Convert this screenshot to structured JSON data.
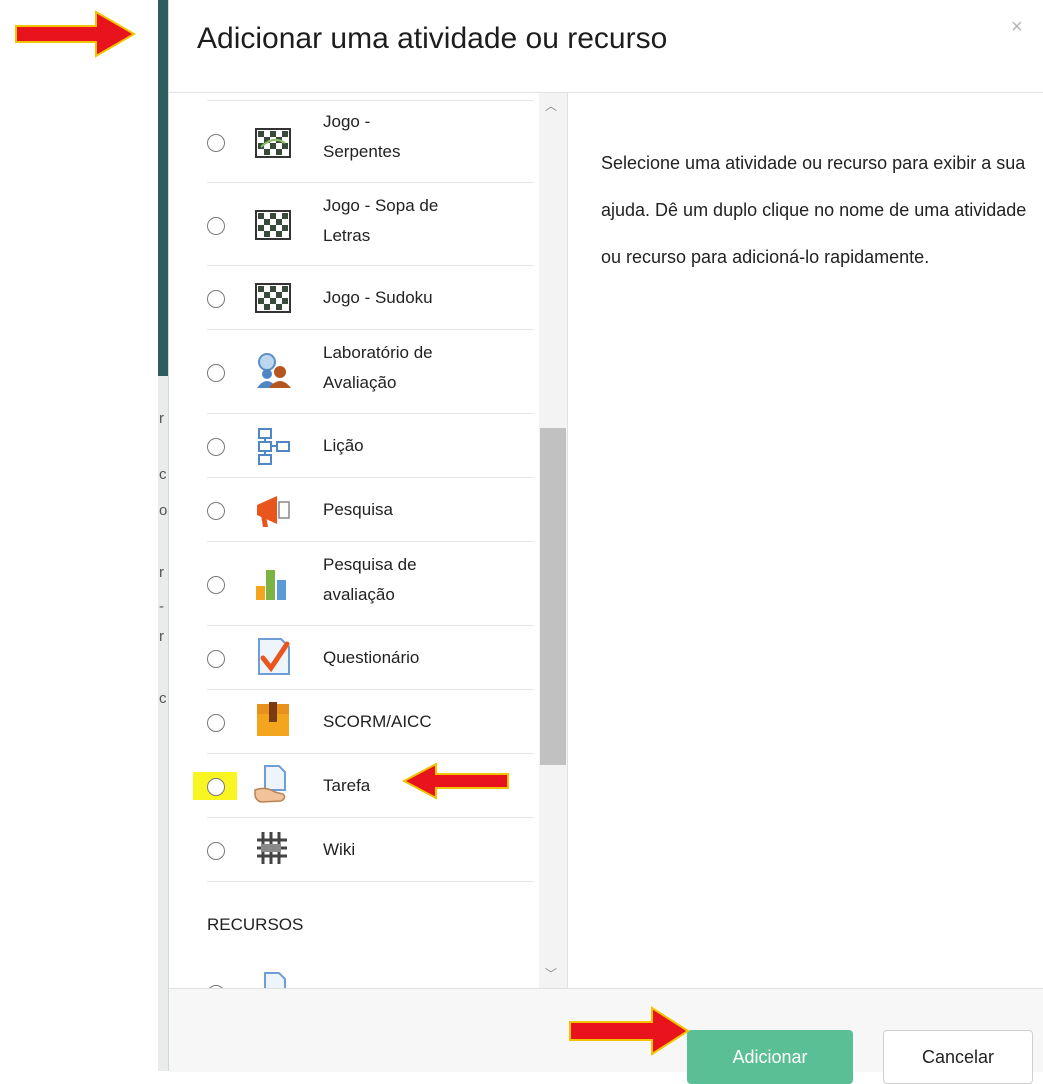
{
  "background": {
    "letters": [
      "r",
      "c",
      "o",
      "r",
      "-",
      "r",
      "c"
    ]
  },
  "modal": {
    "title": "Adicionar uma atividade ou recurso",
    "close_label": "×",
    "options": [
      {
        "label": "Jogo -\nSerpentes",
        "icon": "snakes-game-icon"
      },
      {
        "label": "Jogo - Sopa de\nLetras",
        "icon": "word-search-game-icon"
      },
      {
        "label": "Jogo - Sudoku",
        "icon": "sudoku-game-icon"
      },
      {
        "label": "Laboratório de\nAvaliação",
        "icon": "workshop-icon"
      },
      {
        "label": "Lição",
        "icon": "lesson-icon"
      },
      {
        "label": "Pesquisa",
        "icon": "megaphone-icon"
      },
      {
        "label": "Pesquisa de\navaliação",
        "icon": "bar-chart-icon"
      },
      {
        "label": "Questionário",
        "icon": "quiz-icon"
      },
      {
        "label": "SCORM/AICC",
        "icon": "scorm-package-icon"
      },
      {
        "label": "Tarefa",
        "icon": "assignment-icon"
      },
      {
        "label": "Wiki",
        "icon": "wiki-icon"
      }
    ],
    "section_heading": "RECURSOS",
    "help_text": "Selecione uma atividade ou recurso para exibir a sua ajuda. Dê um duplo clique no nome de uma atividade ou recurso para adicioná-lo rapidamente.",
    "footer": {
      "add_label": "Adicionar",
      "cancel_label": "Cancelar"
    }
  },
  "colors": {
    "accent": "#5bbf95",
    "highlight": "#f9f521",
    "annotation_arrow": "#e8131c"
  }
}
